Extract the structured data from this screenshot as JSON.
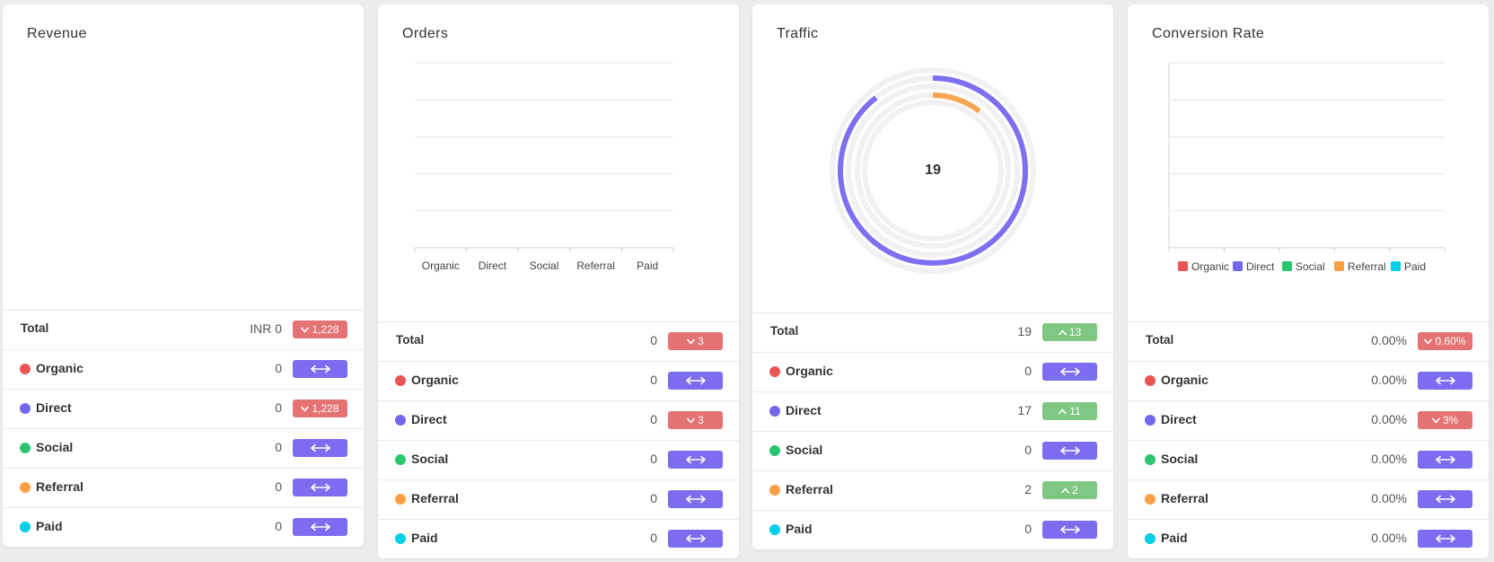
{
  "colors": {
    "organic": "#ea5455",
    "direct": "#7367f0",
    "social": "#28c76f",
    "referral": "#ff9f43",
    "paid": "#00cfe8",
    "badge_down": "#e57373",
    "badge_flat": "#7b6cf0",
    "badge_up": "#81c784"
  },
  "cards": [
    {
      "title": "Revenue",
      "rows": [
        {
          "label": "Total",
          "value": "INR 0",
          "trend": "down",
          "delta": "1,228"
        },
        {
          "label": "Organic",
          "value": "0",
          "trend": "flat",
          "delta": ""
        },
        {
          "label": "Direct",
          "value": "0",
          "trend": "down",
          "delta": "1,228"
        },
        {
          "label": "Social",
          "value": "0",
          "trend": "flat",
          "delta": ""
        },
        {
          "label": "Referral",
          "value": "0",
          "trend": "flat",
          "delta": ""
        },
        {
          "label": "Paid",
          "value": "0",
          "trend": "flat",
          "delta": ""
        }
      ]
    },
    {
      "title": "Orders",
      "chart": {
        "type": "bar",
        "categories": [
          "Organic",
          "Direct",
          "Social",
          "Referral",
          "Paid"
        ],
        "values": [
          0,
          0,
          0,
          0,
          0
        ]
      },
      "rows": [
        {
          "label": "Total",
          "value": "0",
          "trend": "down",
          "delta": "3"
        },
        {
          "label": "Organic",
          "value": "0",
          "trend": "flat",
          "delta": ""
        },
        {
          "label": "Direct",
          "value": "0",
          "trend": "down",
          "delta": "3"
        },
        {
          "label": "Social",
          "value": "0",
          "trend": "flat",
          "delta": ""
        },
        {
          "label": "Referral",
          "value": "0",
          "trend": "flat",
          "delta": ""
        },
        {
          "label": "Paid",
          "value": "0",
          "trend": "flat",
          "delta": ""
        }
      ]
    },
    {
      "title": "Traffic",
      "chart": {
        "type": "radialBar",
        "center_label": "19",
        "series": [
          {
            "name": "Direct",
            "value": 17
          },
          {
            "name": "Referral",
            "value": 2
          }
        ]
      },
      "rows": [
        {
          "label": "Total",
          "value": "19",
          "trend": "up",
          "delta": "13"
        },
        {
          "label": "Organic",
          "value": "0",
          "trend": "flat",
          "delta": ""
        },
        {
          "label": "Direct",
          "value": "17",
          "trend": "up",
          "delta": "11"
        },
        {
          "label": "Social",
          "value": "0",
          "trend": "flat",
          "delta": ""
        },
        {
          "label": "Referral",
          "value": "2",
          "trend": "up",
          "delta": "2"
        },
        {
          "label": "Paid",
          "value": "0",
          "trend": "flat",
          "delta": ""
        }
      ]
    },
    {
      "title": "Conversion Rate",
      "chart": {
        "type": "bar",
        "legend": [
          "Organic",
          "Direct",
          "Social",
          "Referral",
          "Paid"
        ],
        "values": [
          0,
          0,
          0,
          0,
          0
        ]
      },
      "rows": [
        {
          "label": "Total",
          "value": "0.00%",
          "trend": "down",
          "delta": "0.60%"
        },
        {
          "label": "Organic",
          "value": "0.00%",
          "trend": "flat",
          "delta": ""
        },
        {
          "label": "Direct",
          "value": "0.00%",
          "trend": "down",
          "delta": "3%"
        },
        {
          "label": "Social",
          "value": "0.00%",
          "trend": "flat",
          "delta": ""
        },
        {
          "label": "Referral",
          "value": "0.00%",
          "trend": "flat",
          "delta": ""
        },
        {
          "label": "Paid",
          "value": "0.00%",
          "trend": "flat",
          "delta": ""
        }
      ]
    }
  ]
}
